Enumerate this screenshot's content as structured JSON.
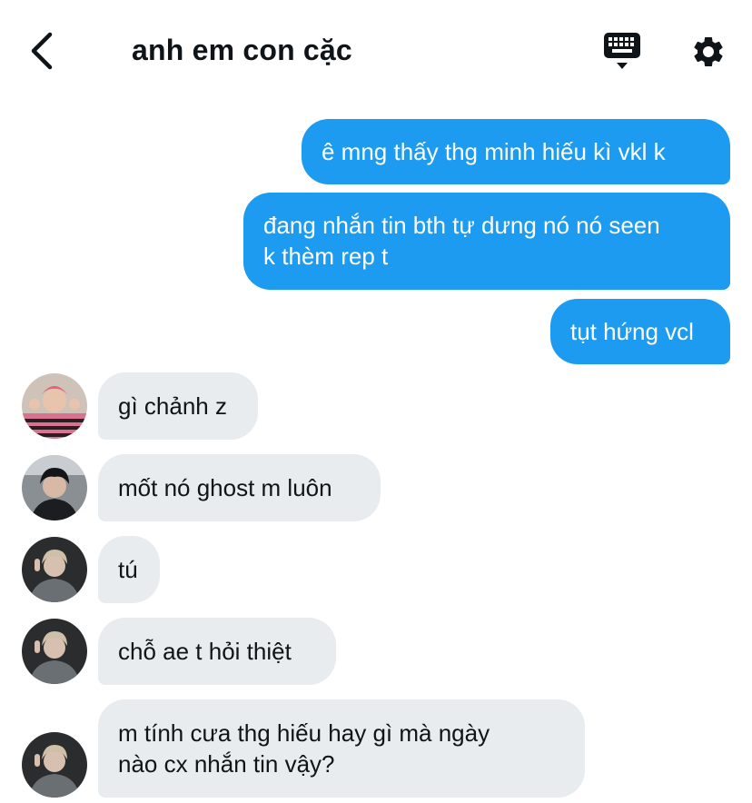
{
  "header": {
    "title": "anh em con cặc",
    "back_icon": "chevron-left-icon",
    "keyboard_icon": "keyboard-icon",
    "settings_icon": "gear-icon"
  },
  "messages": [
    {
      "direction": "outgoing",
      "text": "ê mng thấy thg minh hiếu kì vkl k"
    },
    {
      "direction": "outgoing",
      "text": "đang nhắn tin bth tự dưng nó nó seen\nk thèm rep t"
    },
    {
      "direction": "outgoing",
      "text": "tụt hứng vcl"
    },
    {
      "direction": "incoming",
      "text": "gì chảnh z",
      "avatar": "avatar-pink-hair"
    },
    {
      "direction": "incoming",
      "text": "mốt nó ghost m luôn",
      "avatar": "avatar-dark-hair"
    },
    {
      "direction": "incoming",
      "text": "tú",
      "avatar": "avatar-blond"
    },
    {
      "direction": "incoming",
      "text": "chỗ ae t hỏi thiệt",
      "avatar": "avatar-blond"
    },
    {
      "direction": "incoming",
      "text": "m tính cưa thg hiếu hay gì mà ngày\nnào cx nhắn tin vậy?",
      "avatar": "avatar-blond"
    }
  ],
  "colors": {
    "outgoing_bubble": "#1d9bf0",
    "incoming_bubble": "#e8ecef",
    "text": "#0f1419"
  }
}
